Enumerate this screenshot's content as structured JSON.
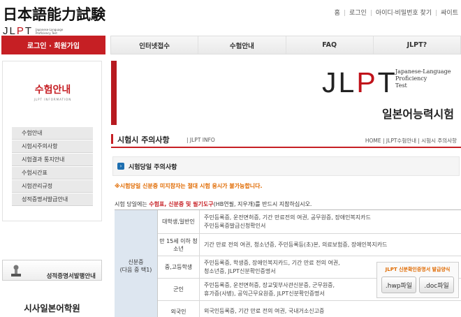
{
  "header": {
    "logo_title": "日本語能力試験",
    "logo_jlpt_j": "JL",
    "logo_jlpt_p": "P",
    "logo_jlpt_t": "T",
    "logo_mini": "Japanese-Language Proficiency Test",
    "top_links": [
      "홈",
      "로그인",
      "아이디·비밀번호 찾기",
      "싸이트"
    ]
  },
  "nav": {
    "login_label": "로그인 · 회원가입",
    "items": [
      "인터넷접수",
      "수험안내",
      "FAQ",
      "JLPT?"
    ]
  },
  "sidebar": {
    "title": "수험안내",
    "subtitle": "JLPT INFORMATION",
    "items": [
      "수험안내",
      "시험시주의사항",
      "시험결과 통지안내",
      "수험시간표",
      "시험관리규정",
      "성적증명서발급안내"
    ],
    "cert_label": "성적증명서발행안내",
    "academy": "시사일본어학원"
  },
  "banner": {
    "jlpt_j": "J",
    "jlpt_l": "L",
    "jlpt_p": "P",
    "jlpt_t": "T",
    "en_line1": "Japanese-Language",
    "en_line2": "Proficiency",
    "en_line3": "Test",
    "ko_title": "일본어능력시험"
  },
  "section": {
    "title": "시험시 주의사항",
    "eng": "| JLPT INFO",
    "breadcrumb": "HOME | JLPT수험안내 | 시험시 주의사항"
  },
  "content": {
    "sub_title": "시험당일 주의사항",
    "warning": "※시험당일 신분증 미지참자는 절대 시험 응시가 불가능합니다.",
    "intro_pre": "시험 당일에는 ",
    "intro_hl": "수험표, 신분증 및 필기도구",
    "intro_post": "(HB연필, 지우개)를 반드시 지참하십시오.",
    "category_line1": "신분증",
    "category_line2": "(다음 중 택1)",
    "rows": [
      {
        "group": "대학생,일반인",
        "docs1": "주민등록증, 운전면허증, 기간 만료전의 여권, 공무원증, 장애인복지카드",
        "docs2": "주민등록증발급신청확인서"
      },
      {
        "group": "만 15세 이하 청소년",
        "docs1": "기간 만료 전의 여권, 청소년증, 주민등록등(초)본, 의료보험증, 장애인복지카드",
        "docs2": ""
      },
      {
        "group": "중,고등학생",
        "docs1": "주민등록증, 학생증, 장애인복지카드, 기간 만료 전의 여권,",
        "docs2": "청소년증, JLPT신분확인증명서"
      },
      {
        "group": "군인",
        "docs1": "주민등록증, 운전면허증, 장교및부사관신분증, 군무원증,",
        "docs2": "휴가증(사병), 공익근무요원증, JLPT신분확인증명서"
      },
      {
        "group": "외국인",
        "docs1": "외국인등록증, 기간 만료 전의 여권, 국내거소신고증",
        "docs2": ""
      }
    ],
    "download_title": "JLPT 신분확인증명서 발급양식",
    "download_hwp": ".hwp파일",
    "download_doc": ".doc파일"
  },
  "colors": {
    "brand_red": "#c61f24",
    "warning_orange": "#e06a00",
    "category_blue": "#dde6f0"
  }
}
